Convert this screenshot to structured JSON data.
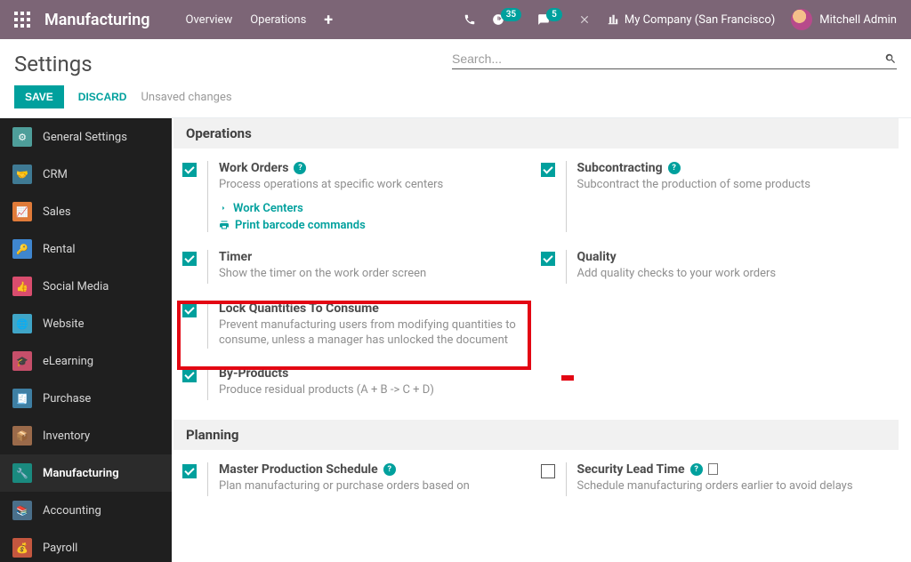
{
  "topnav": {
    "brand": "Manufacturing",
    "links": {
      "overview": "Overview",
      "operations": "Operations"
    },
    "badges": {
      "activities": "35",
      "messages": "5"
    },
    "company": "My Company (San Francisco)",
    "user": "Mitchell Admin"
  },
  "subhead": {
    "title": "Settings",
    "save": "SAVE",
    "discard": "DISCARD",
    "unsaved": "Unsaved changes",
    "search_placeholder": "Search..."
  },
  "sidebar": {
    "items": [
      {
        "label": "General Settings"
      },
      {
        "label": "CRM"
      },
      {
        "label": "Sales"
      },
      {
        "label": "Rental"
      },
      {
        "label": "Social Media"
      },
      {
        "label": "Website"
      },
      {
        "label": "eLearning"
      },
      {
        "label": "Purchase"
      },
      {
        "label": "Inventory"
      },
      {
        "label": "Manufacturing"
      },
      {
        "label": "Accounting"
      },
      {
        "label": "Payroll"
      }
    ]
  },
  "sections": {
    "operations": {
      "heading": "Operations",
      "work_orders": {
        "title": "Work Orders",
        "desc": "Process operations at specific work centers",
        "link1": "Work Centers",
        "link2": "Print barcode commands"
      },
      "subcontracting": {
        "title": "Subcontracting",
        "desc": "Subcontract the production of some products"
      },
      "timer": {
        "title": "Timer",
        "desc": "Show the timer on the work order screen"
      },
      "quality": {
        "title": "Quality",
        "desc": "Add quality checks to your work orders"
      },
      "lock_qty": {
        "title": "Lock Quantities To Consume",
        "desc": "Prevent manufacturing users from modifying quantities to consume, unless a manager has unlocked the document"
      },
      "byproducts": {
        "title": "By-Products",
        "desc": "Produce residual products (A + B -> C + D)"
      }
    },
    "planning": {
      "heading": "Planning",
      "mps": {
        "title": "Master Production Schedule",
        "desc": "Plan manufacturing or purchase orders based on"
      },
      "security": {
        "title": "Security Lead Time",
        "desc": "Schedule manufacturing orders earlier to avoid delays"
      }
    }
  }
}
